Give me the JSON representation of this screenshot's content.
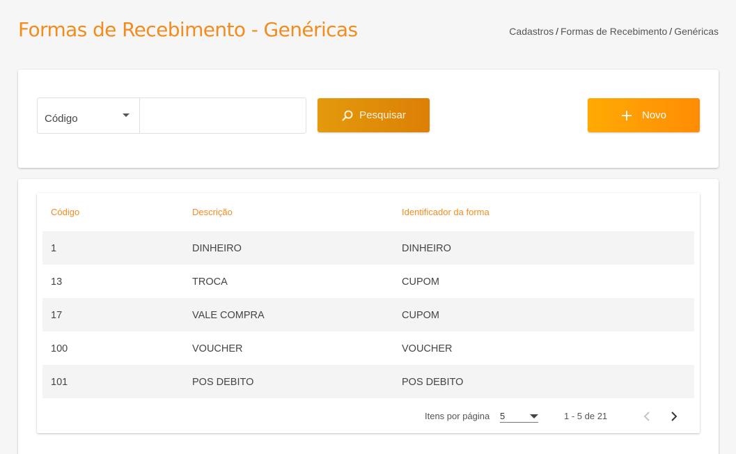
{
  "header": {
    "title": "Formas de Recebimento - Genéricas",
    "breadcrumb": [
      "Cadastros",
      "Formas de Recebimento",
      "Genéricas"
    ]
  },
  "search": {
    "filter_selected": "Código",
    "input_value": "",
    "search_button": "Pesquisar",
    "new_button": "Novo"
  },
  "table": {
    "columns": [
      "Código",
      "Descrição",
      "Identificador da forma"
    ],
    "rows": [
      [
        "1",
        "DINHEIRO",
        "DINHEIRO"
      ],
      [
        "13",
        "TROCA",
        "CUPOM"
      ],
      [
        "17",
        "VALE COMPRA",
        "CUPOM"
      ],
      [
        "100",
        "VOUCHER",
        "VOUCHER"
      ],
      [
        "101",
        "POS DEBITO",
        "POS DEBITO"
      ]
    ]
  },
  "paginator": {
    "items_per_page_label": "Itens por página",
    "page_size": "5",
    "range": "1 - 5 de 21"
  },
  "colors": {
    "accent": "#f28c1e",
    "search_button": "#e39a0b",
    "new_button": "#ff9a04"
  },
  "icons": {
    "search": "magnifier-icon",
    "new": "plus-icon",
    "prev": "chevron-left-icon",
    "next": "chevron-right-icon"
  }
}
